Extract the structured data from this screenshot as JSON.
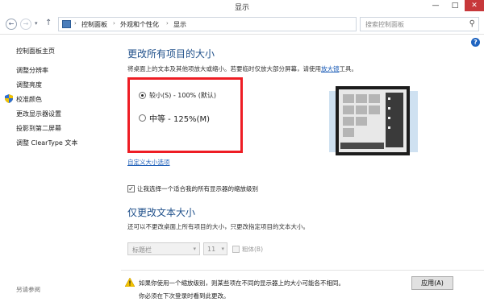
{
  "window": {
    "title": "显示",
    "minimize": "—",
    "maximize": "□",
    "close": "✕"
  },
  "nav": {
    "back": "←",
    "forward": "→",
    "dropdown": "▾",
    "up": "↑"
  },
  "address": {
    "crumbs": [
      "控制面板",
      "外观和个性化",
      "显示"
    ],
    "separator": "›",
    "dropdown": "▾",
    "refresh": "↻"
  },
  "search": {
    "placeholder": "搜索控制面板",
    "icon": "⚲"
  },
  "help": "?",
  "sidebar": {
    "home": "控制面板主页",
    "links": [
      "调整分辨率",
      "调整亮度",
      "校准颜色",
      "更改显示器设置",
      "投影到第二屏幕",
      "调整 ClearType 文本"
    ],
    "see_also": "另请参阅"
  },
  "main": {
    "heading": "更改所有项目的大小",
    "description": "将桌面上的文本及其他项放大或缩小。若要临时仅放大部分屏幕，请使用",
    "magnifier_link": "放大镜",
    "description_end": "工具。",
    "options": [
      {
        "label": "较小(S) - 100% (默认)",
        "selected": true
      },
      {
        "label": "中等 - 125%(M)",
        "selected": false
      }
    ],
    "custom_size_link": "自定义大小选项",
    "checkbox_label": "让我选择一个适合我的所有显示器的缩放级别",
    "checkbox_checked": true,
    "checkmark": "✓",
    "heading2": "仅更改文本大小",
    "description2": "还可以不更改桌面上所有项目的大小，只更改指定项目的文本大小。",
    "text_item": {
      "value": "标题栏",
      "arrow": "▾"
    },
    "font_size": {
      "value": "11",
      "arrow": "▾"
    },
    "bold_label": "粗体(B)",
    "warning_text": "如果你使用一个缩放级别，则某些项在不同的显示器上的大小可能各不相同。",
    "warning_text2": "你必须在下次登录时看到此更改。",
    "apply_label": "应用(A)"
  },
  "colors": {
    "heading": "#1e4f8a",
    "link": "#1f5fb8",
    "highlight_box": "#ee1d24",
    "close_button": "#c7383a"
  }
}
